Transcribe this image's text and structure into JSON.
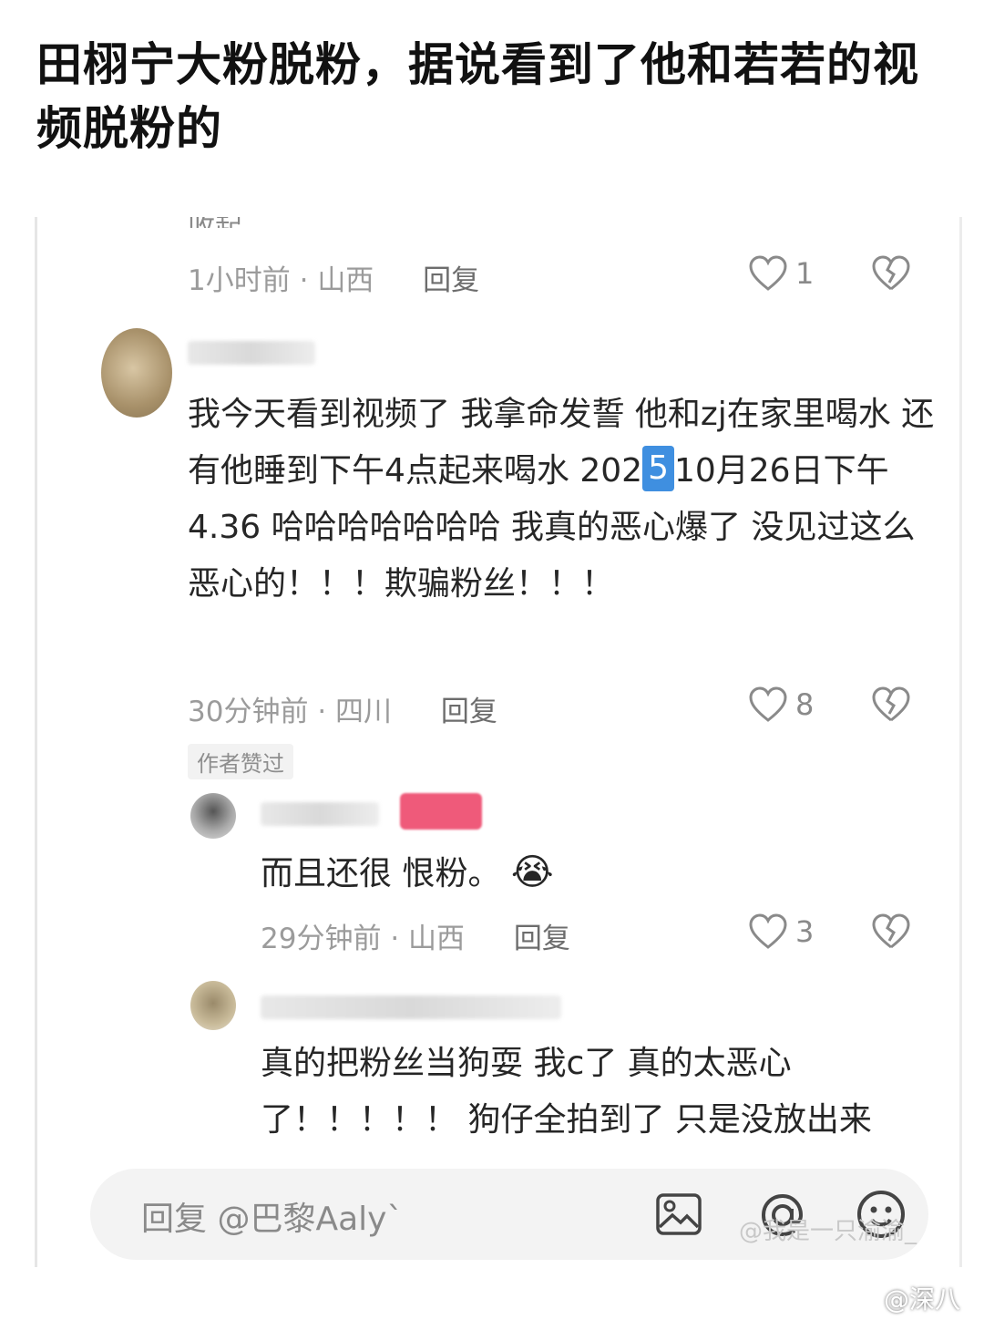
{
  "headline": "田栩宁大粉脱粉，据说看到了他和若若的视频脱粉的",
  "collapse_label": "收起",
  "comments": [
    {
      "time": "1小时前",
      "location": "山西",
      "reply_label": "回复",
      "likes": "1"
    },
    {
      "text_part1": "我今天看到视频了 我拿命发誓 他和zj在家里喝水 还有他睡到下午4点起来喝水 202",
      "marker": "5",
      "text_part2": "10月26日下午4.36 哈哈哈哈哈哈哈 我真的恶心爆了 没见过这么恶心的！！！欺骗粉丝！！！",
      "time": "30分钟前",
      "location": "四川",
      "reply_label": "回复",
      "likes": "8",
      "author_liked_tag": "作者赞过"
    },
    {
      "text": "而且还很 恨粉。",
      "emoji": "😭",
      "time": "29分钟前",
      "location": "山西",
      "reply_label": "回复",
      "likes": "3"
    },
    {
      "text": "真的把粉丝当狗耍 我c了 真的太恶心了！！！！！ 狗仔全拍到了 只是没放出来"
    }
  ],
  "separator": "·",
  "reply_input": {
    "placeholder": "回复 @巴黎Aaly`"
  },
  "icons": [
    "heart-icon",
    "broken-heart-icon",
    "image-icon",
    "at-icon",
    "emoji-icon"
  ],
  "watermarks": {
    "inner": "@我是一只渝渝_",
    "outer": "@深八"
  }
}
